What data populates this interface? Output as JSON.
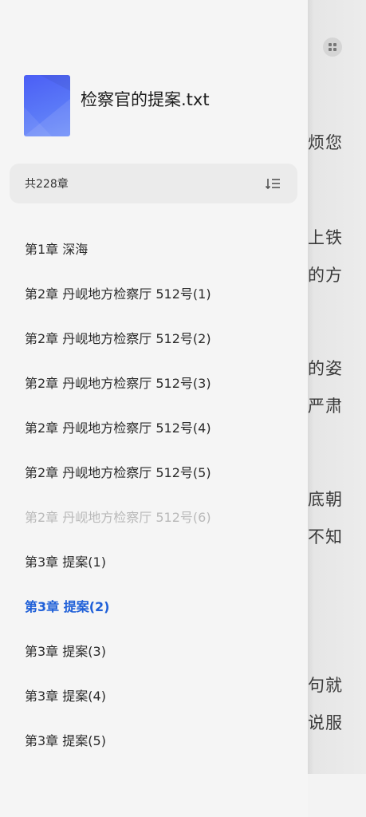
{
  "reader": {
    "lines": [
      "烦您",
      "上铁",
      "的方",
      "的姿",
      "严肃",
      "底朝",
      "不知",
      "句就",
      "说服"
    ]
  },
  "book": {
    "title": "检察官的提案.txt",
    "chapter_count": "共228章"
  },
  "chapters": [
    {
      "label": "第1章 深海",
      "state": "normal"
    },
    {
      "label": "第2章 丹岘地方检察厅 512号(1)",
      "state": "normal"
    },
    {
      "label": "第2章 丹岘地方检察厅 512号(2)",
      "state": "normal"
    },
    {
      "label": "第2章 丹岘地方检察厅 512号(3)",
      "state": "normal"
    },
    {
      "label": "第2章 丹岘地方检察厅 512号(4)",
      "state": "normal"
    },
    {
      "label": "第2章 丹岘地方检察厅 512号(5)",
      "state": "normal"
    },
    {
      "label": "第2章 丹岘地方检察厅 512号(6)",
      "state": "dim"
    },
    {
      "label": "第3章 提案(1)",
      "state": "normal"
    },
    {
      "label": "第3章 提案(2)",
      "state": "active"
    },
    {
      "label": "第3章 提案(3)",
      "state": "normal"
    },
    {
      "label": "第3章 提案(4)",
      "state": "normal"
    },
    {
      "label": "第3章 提案(5)",
      "state": "normal"
    }
  ],
  "colors": {
    "active": "#2060d8",
    "dim": "#b9b9b9",
    "cover": "#4b5ef5"
  },
  "icons": {
    "grid": "grid-icon",
    "sort": "sort-order-icon",
    "cover": "book-cover-icon"
  }
}
